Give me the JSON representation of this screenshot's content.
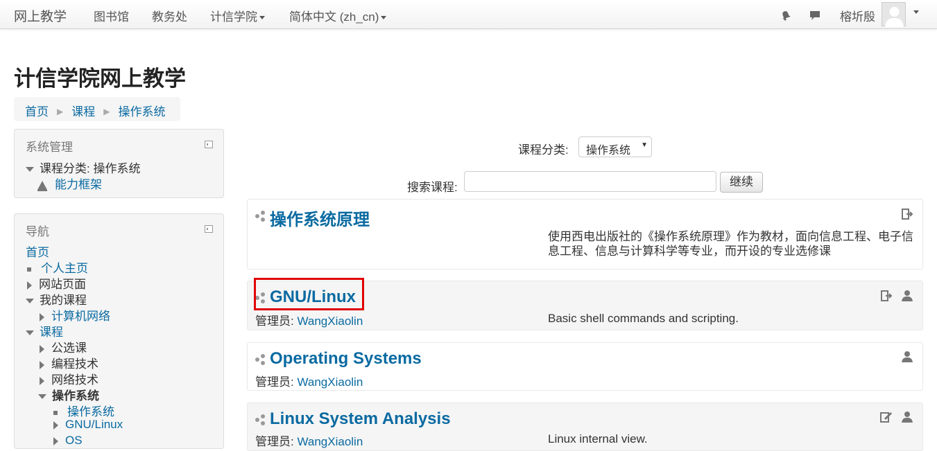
{
  "navbar": {
    "brand": "网上教学",
    "items": [
      {
        "label": "图书馆",
        "has_caret": false
      },
      {
        "label": "教务处",
        "has_caret": false
      },
      {
        "label": "计信学院",
        "has_caret": true
      },
      {
        "label": "简体中文 (zh_cn)",
        "has_caret": true
      }
    ],
    "icons": [
      "notification-bell-icon",
      "message-bubble-icon"
    ],
    "user_name": "榕圻殷"
  },
  "header": {
    "title": "计信学院网上教学",
    "breadcrumb": [
      "首页",
      "课程",
      "操作系统"
    ]
  },
  "admin_block": {
    "title": "系统管理",
    "category_label": "课程分类: 操作系统",
    "competency_label": "能力框架"
  },
  "nav_block": {
    "title": "导航",
    "home": "首页",
    "dashboard": "个人主页",
    "site_pages": "网站页面",
    "my_courses": "我的课程",
    "my_course_item": "计算机网络",
    "courses": "课程",
    "categories": [
      "公选课",
      "编程技术",
      "网络技术"
    ],
    "current_category": "操作系统",
    "current_category_item": "操作系统",
    "sub_courses": [
      "GNU/Linux",
      "OS"
    ]
  },
  "main": {
    "category_label": "课程分类:",
    "category_value": "操作系统",
    "search_label": "搜索课程:",
    "search_value": "",
    "search_button": "继续",
    "courses": [
      {
        "name": "操作系统原理",
        "manager_label": "",
        "manager": "",
        "summary": "使用西电出版社的《操作系统原理》作为教材，面向信息工程、电子信息工程、信息与计算科学等专业，而开设的专业选修课",
        "actions": [
          "enrol-icon"
        ]
      },
      {
        "name": "GNU/Linux",
        "manager_label": "管理员:",
        "manager": "WangXiaolin",
        "summary": "Basic shell commands and scripting.",
        "actions": [
          "enrol-icon",
          "guest-icon"
        ]
      },
      {
        "name": "Operating Systems",
        "manager_label": "管理员:",
        "manager": "WangXiaolin",
        "summary": "",
        "actions": [
          "guest-icon"
        ]
      },
      {
        "name": "Linux System Analysis",
        "manager_label": "管理员:",
        "manager": "WangXiaolin",
        "summary": "Linux internal view.",
        "actions": [
          "self-enrol-icon",
          "guest-icon"
        ]
      }
    ]
  },
  "colors": {
    "link": "#0a6aa1",
    "highlight": "#e00000",
    "block_bg": "#f5f5f5"
  }
}
